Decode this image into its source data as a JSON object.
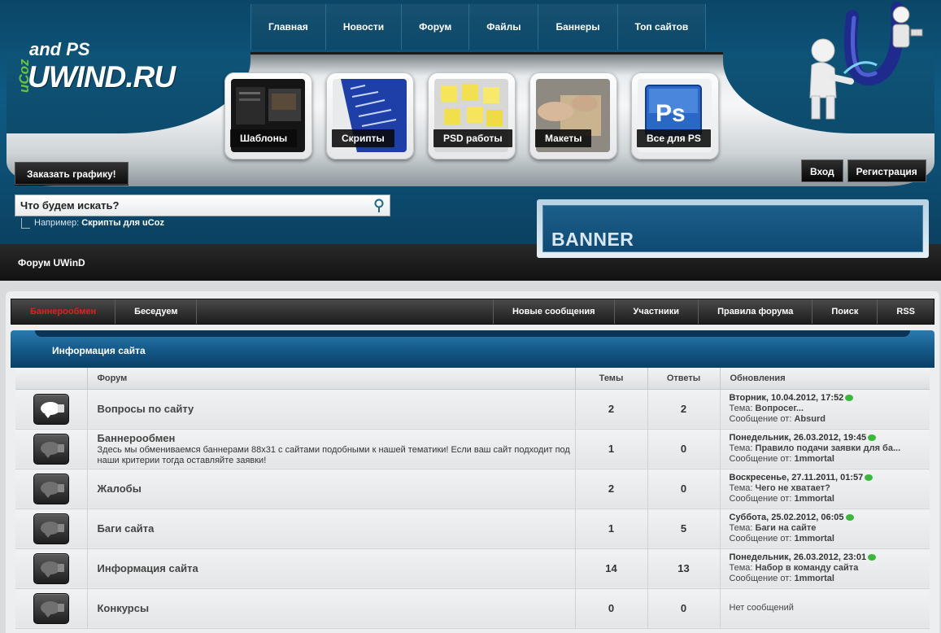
{
  "logo": {
    "ucoz": "uCoz",
    "and_ps": "and PS",
    "site": "UWIND.RU"
  },
  "top_nav": [
    "Главная",
    "Новости",
    "Форум",
    "Файлы",
    "Баннеры",
    "Топ сайтов"
  ],
  "tiles": [
    {
      "label": "Шаблоны",
      "icon": "templates-thumbnail"
    },
    {
      "label": "Скрипты",
      "icon": "scripts-thumbnail"
    },
    {
      "label": "PSD работы",
      "icon": "psd-notes-thumbnail"
    },
    {
      "label": "Макеты",
      "icon": "mockups-thumbnail"
    },
    {
      "label": "Все для PS",
      "icon": "photoshop-thumbnail"
    }
  ],
  "order_button": "Заказать графику!",
  "auth": {
    "login": "Вход",
    "register": "Регистрация"
  },
  "search": {
    "placeholder": "Что будем искать?",
    "hint_prefix": "Например:",
    "hint_example": "Скрипты для uCoz"
  },
  "banner": "BANNER",
  "forum_title": "Форум UWinD",
  "forum_nav": {
    "left": [
      "Баннерообмен",
      "Беседуем"
    ],
    "right": [
      "Новые сообщения",
      "Участники",
      "Правила форума",
      "Поиск",
      "RSS"
    ],
    "active": "Баннерообмен"
  },
  "category_title": "Информация сайта",
  "columns": {
    "forum": "Форум",
    "topics": "Темы",
    "replies": "Ответы",
    "updates": "Обновления"
  },
  "forums": [
    {
      "name": "Вопросы по сайту",
      "desc": "",
      "topics": "2",
      "replies": "2",
      "unread": true,
      "date": "Вторник, 10.04.2012, 17:52",
      "topic": "Вопросег...",
      "author": "Absurd"
    },
    {
      "name": "Баннерообмен",
      "desc": "Здесь мы обмениваемся баннерами 88x31 с сайтами подобными к нашей тематики! Если ваш сайт подходит под наши критерии тогда оставляйте заявки!",
      "topics": "1",
      "replies": "0",
      "unread": false,
      "date": "Понедельник, 26.03.2012, 19:45",
      "topic": "Правило подачи заявки для ба...",
      "author": "1mmortal"
    },
    {
      "name": "Жалобы",
      "desc": "",
      "topics": "2",
      "replies": "0",
      "unread": false,
      "date": "Воскресенье, 27.11.2011, 01:57",
      "topic": "Чего не хватает?",
      "author": "1mmortal"
    },
    {
      "name": "Баги сайта",
      "desc": "",
      "topics": "1",
      "replies": "5",
      "unread": false,
      "date": "Суббота, 25.02.2012, 06:05",
      "topic": "Баги на сайте",
      "author": "1mmortal"
    },
    {
      "name": "Информация сайта",
      "desc": "",
      "topics": "14",
      "replies": "13",
      "unread": false,
      "date": "Понедельник, 26.03.2012, 23:01",
      "topic": "Набор в команду сайта",
      "author": "1mmortal"
    },
    {
      "name": "Конкурсы",
      "desc": "",
      "topics": "0",
      "replies": "0",
      "unread": false,
      "no_messages": "Нет сообщений"
    }
  ],
  "labels": {
    "topic_prefix": "Тема:",
    "author_prefix": "Сообщение от:"
  },
  "colors": {
    "accent_blue": "#0f5b84",
    "active_nav": "#e02020",
    "new_dot": "#3ab83a"
  }
}
